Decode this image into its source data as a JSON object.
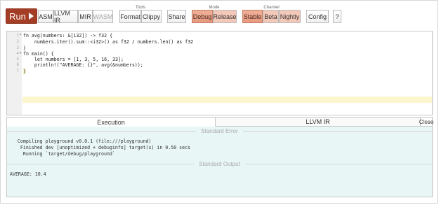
{
  "toolbar": {
    "run_label": "Run",
    "asm_label": "ASM",
    "llvm_ir_label": "LLVM IR",
    "mir_label": "MIR",
    "wasm_label": "WASM",
    "tools_group_label": "Tools",
    "format_label": "Format",
    "clippy_label": "Clippy",
    "share_label": "Share",
    "mode_group_label": "Mode",
    "debug_label": "Debug",
    "release_label": "Release",
    "channel_group_label": "Channel",
    "stable_label": "Stable",
    "beta_label": "Beta",
    "nightly_label": "Nightly",
    "config_label": "Config",
    "help_label": "?"
  },
  "editor": {
    "line_numbers": [
      "1",
      "2",
      "3",
      "4",
      "5",
      "6",
      "7"
    ],
    "lines": [
      "fn avg(numbers: &[i32]) -> f32 {",
      "    numbers.iter().sum::<i32>() as f32 / numbers.len() as f32",
      "}",
      "fn main() {",
      "    let numbers = [1, 3, 5, 16, 33];",
      "    println!(\"AVERAGE: {}\", avg(&numbers));",
      "}"
    ]
  },
  "output": {
    "tabs": {
      "execution": "Execution",
      "llvm_ir": "LLVM IR",
      "close": "Close"
    },
    "stderr_header": "Standard Error",
    "stderr_lines": [
      "   Compiling playground v0.0.1 (file:///playground)",
      "    Finished dev [unoptimized + debuginfo] target(s) in 0.50 secs",
      "     Running `target/debug/playground`"
    ],
    "stdout_header": "Standard Output",
    "stdout_text": "AVERAGE: 10.4"
  },
  "colors": {
    "run_button": "#a43d25",
    "active_toggle": "#e79a80",
    "output_background": "#e9f6f6",
    "current_line": "#fbf6cd"
  }
}
